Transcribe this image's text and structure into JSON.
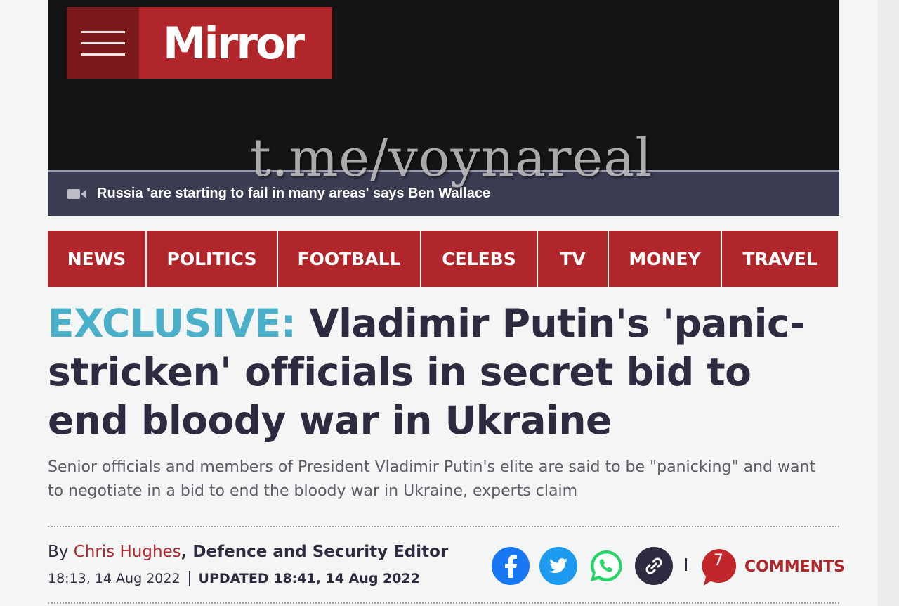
{
  "brand": {
    "logo_text": "Mirror",
    "accent": "#b0262a"
  },
  "video": {
    "title": "Russia 'are starting to fail in many areas' says Ben Wallace"
  },
  "watermark": "t.me/voynareal",
  "nav": {
    "items": [
      "NEWS",
      "POLITICS",
      "FOOTBALL",
      "CELEBS",
      "TV",
      "MONEY",
      "TRAVEL"
    ]
  },
  "article": {
    "kicker": "EXCLUSIVE:",
    "headline": "Vladimir Putin's 'panic-stricken' officials in secret bid to end bloody war in Ukraine",
    "standfirst": "Senior officials and members of President Vladimir Putin's elite are said to be \"panicking\" and want to negotiate in a bid to end the bloody war in Ukraine, experts claim",
    "byline_prefix": "By",
    "author": "Chris Hughes",
    "role": ", Defence and Security Editor",
    "published": "18:13, 14 Aug 2022",
    "updated": "UPDATED 18:41, 14 Aug 2022"
  },
  "share": {
    "icons": [
      "facebook-icon",
      "twitter-icon",
      "whatsapp-icon",
      "link-icon"
    ],
    "comment_count": "7",
    "comments_label": "COMMENTS"
  }
}
